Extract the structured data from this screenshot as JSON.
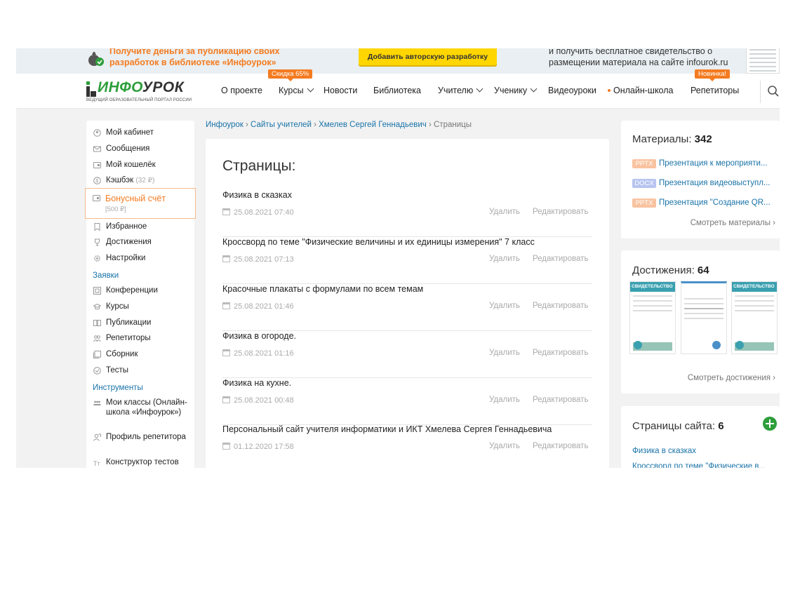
{
  "banner": {
    "promo": "Получите деньги за публикацию своих разработок в библиотеке «Инфоурок»",
    "cta": "Добавить авторскую разработку",
    "info": "и получить бесплатное свидетельство о размещении материала на сайте infourok.ru"
  },
  "header": {
    "logo_a": "ИНФО",
    "logo_b": "УРОК",
    "logo_tagline": "ВЕДУЩИЙ ОБРАЗОВАТЕЛЬНЫЙ ПОРТАЛ РОССИИ",
    "nav": [
      "О проекте",
      "Курсы",
      "Новости",
      "Библиотека",
      "Учителю",
      "Ученику",
      "Видеоуроки",
      "Онлайн-школа",
      "Репетиторы"
    ],
    "badge_courses": "Скидка 65%",
    "badge_tutors": "Новинка!"
  },
  "sidebar": {
    "items": [
      {
        "label": "Мой кабинет",
        "icon": "user-icon"
      },
      {
        "label": "Сообщения",
        "icon": "mail-icon"
      },
      {
        "label": "Мой кошелёк",
        "icon": "wallet-icon"
      },
      {
        "label": "Кэшбэк",
        "count": "(32 ₽)",
        "icon": "cashback-icon"
      },
      {
        "label": "Избранное",
        "icon": "bookmark-icon"
      },
      {
        "label": "Достижения",
        "icon": "trophy-icon"
      },
      {
        "label": "Настройки",
        "icon": "gear-icon"
      }
    ],
    "bonus": {
      "label": "Бонусный счёт",
      "sub": "[500 ₽]"
    },
    "section_requests": "Заявки",
    "requests": [
      {
        "label": "Конференции",
        "icon": "conference-icon"
      },
      {
        "label": "Курсы",
        "icon": "graduation-icon"
      },
      {
        "label": "Публикации",
        "icon": "book-icon"
      },
      {
        "label": "Репетиторы",
        "icon": "people-icon"
      },
      {
        "label": "Сборник",
        "icon": "collection-icon"
      },
      {
        "label": "Тесты",
        "icon": "check-icon"
      }
    ],
    "section_tools": "Инструменты",
    "tools": [
      {
        "label": "Мои классы (Онлайн-школа «Инфоурок»)",
        "icon": "classes-icon"
      },
      {
        "label": "Профиль репетитора",
        "icon": "tutor-icon"
      },
      {
        "label": "Конструктор тестов",
        "icon": "text-icon"
      }
    ]
  },
  "breadcrumb": {
    "items": [
      "Инфоурок",
      "Сайты учителей",
      "Хмелев Сергей Геннадьевич"
    ],
    "current": "Страницы",
    "sep": "›"
  },
  "main": {
    "title": "Страницы:",
    "delete_label": "Удалить",
    "edit_label": "Редактировать",
    "pages": [
      {
        "title": "Физика в сказках",
        "date": "25.08.2021 07:40"
      },
      {
        "title": "Кроссворд по теме \"Физические величины и их единицы измерения\" 7 класс",
        "date": "25.08.2021 07:13"
      },
      {
        "title": "Красочные плакаты с формулами по всем темам",
        "date": "25.08.2021 01:46"
      },
      {
        "title": "Физика в огороде.",
        "date": "25.08.2021 01:16"
      },
      {
        "title": "Физика на кухне.",
        "date": "25.08.2021 00:48"
      },
      {
        "title": "Персональный сайт учителя информатики и ИКТ Хмелева Сергея Геннадьевича",
        "date": "01.12.2020 17:58"
      }
    ]
  },
  "right": {
    "materials_label": "Материалы:",
    "materials_count": "342",
    "materials": [
      {
        "tag": "PPTX",
        "color": "#f9c3a0",
        "title": "Презентация к мероприяти..."
      },
      {
        "tag": "DOCX",
        "color": "#b8c4f0",
        "title": "Презентация видеовыступл..."
      },
      {
        "tag": "PPTX",
        "color": "#f9c3a0",
        "title": "Презентация \"Создание QR..."
      }
    ],
    "materials_more": "Смотреть материалы ›",
    "achievements_label": "Достижения:",
    "achievements_count": "64",
    "cert_heading": "СВИДЕТЕЛЬСТВО",
    "achievements_more": "Смотреть достижения ›",
    "site_pages_label": "Страницы сайта:",
    "site_pages_count": "6",
    "site_pages": [
      "Физика в сказках",
      "Кроссворд по теме \"Физические в..."
    ]
  },
  "colors": {
    "accent": "#f47b20",
    "link": "#1a73a8",
    "brand_green": "#2d9e3a"
  }
}
